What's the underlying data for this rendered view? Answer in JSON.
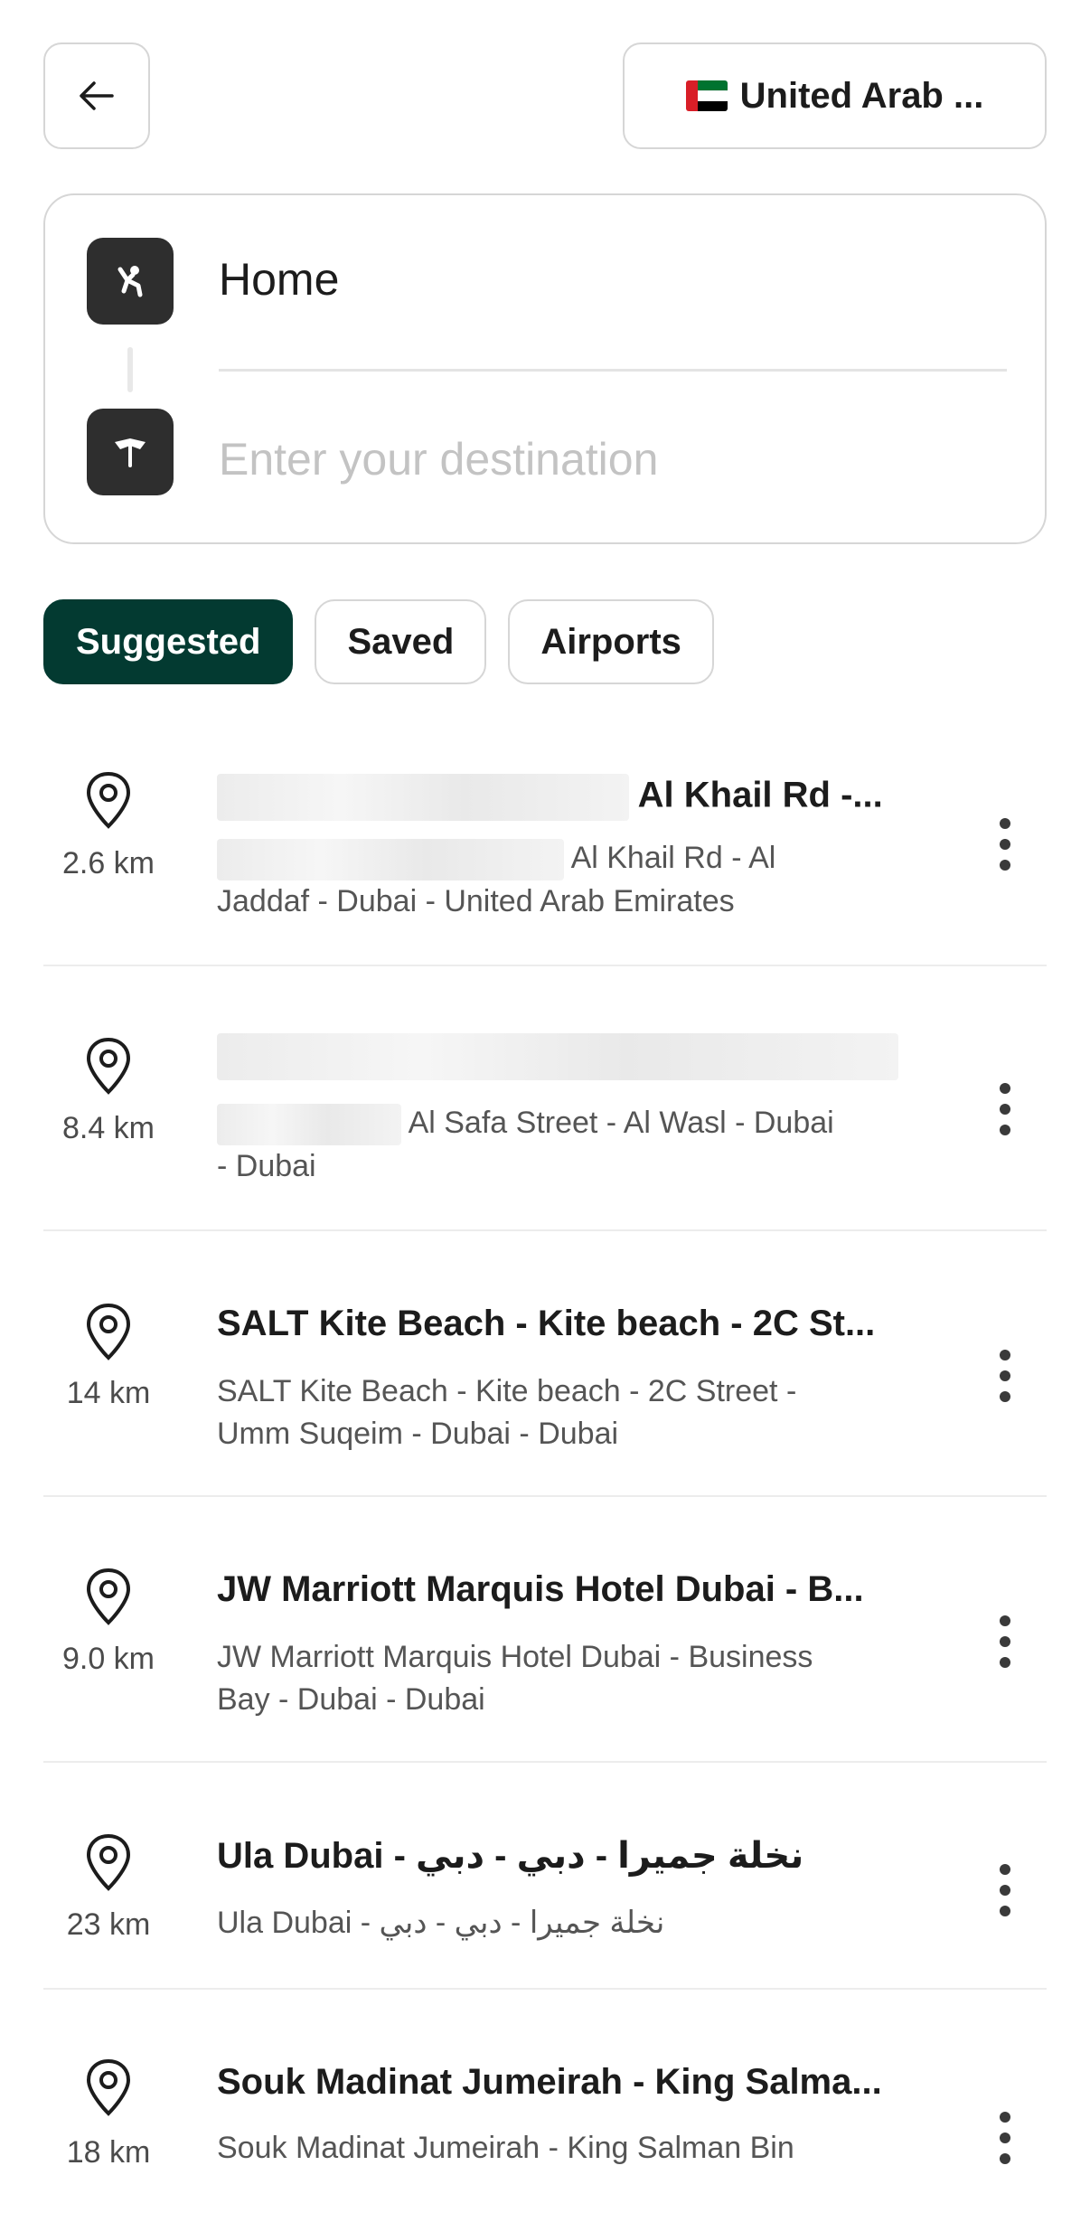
{
  "header": {
    "back_icon": "arrow-left-icon",
    "country_label": "United Arab ...",
    "flag_colors": [
      "#d81e27",
      "#00732f",
      "#ffffff",
      "#000000"
    ]
  },
  "route": {
    "origin": "Home",
    "destination_placeholder": "Enter your destination",
    "origin_icon": "person-waving-icon",
    "destination_icon": "flag-pin-icon"
  },
  "tabs": [
    {
      "label": "Suggested",
      "active": true
    },
    {
      "label": "Saved",
      "active": false
    },
    {
      "label": "Airports",
      "active": false
    }
  ],
  "accent_color": "#033a31",
  "places": [
    {
      "distance": "2.6 km",
      "title": "Al Khail Rd -...",
      "subtitle_line1": "Al Khail Rd - Al",
      "subtitle_line2": "Jaddaf - Dubai - United Arab Emirates"
    },
    {
      "distance": "8.4 km",
      "title": "",
      "subtitle_line1": "Al Safa Street - Al Wasl - Dubai",
      "subtitle_line2": "- Dubai"
    },
    {
      "distance": "14 km",
      "title": "SALT Kite Beach - Kite beach - 2C St...",
      "subtitle_line1": "SALT Kite Beach - Kite beach - 2C Street -",
      "subtitle_line2": "Umm Suqeim - Dubai - Dubai"
    },
    {
      "distance": "9.0 km",
      "title": "JW Marriott Marquis Hotel Dubai - B...",
      "subtitle_line1": "JW Marriott Marquis Hotel Dubai - Business",
      "subtitle_line2": "Bay - Dubai - Dubai"
    },
    {
      "distance": "23 km",
      "title": "Ula Dubai - نخلة جميرا - دبي - دبي",
      "subtitle_line1": "Ula Dubai - نخلة جميرا - دبي - دبي",
      "subtitle_line2": ""
    },
    {
      "distance": "18 km",
      "title": "Souk Madinat Jumeirah - King Salma...",
      "subtitle_line1": "Souk Madinat Jumeirah - King Salman Bin",
      "subtitle_line2": ""
    }
  ]
}
